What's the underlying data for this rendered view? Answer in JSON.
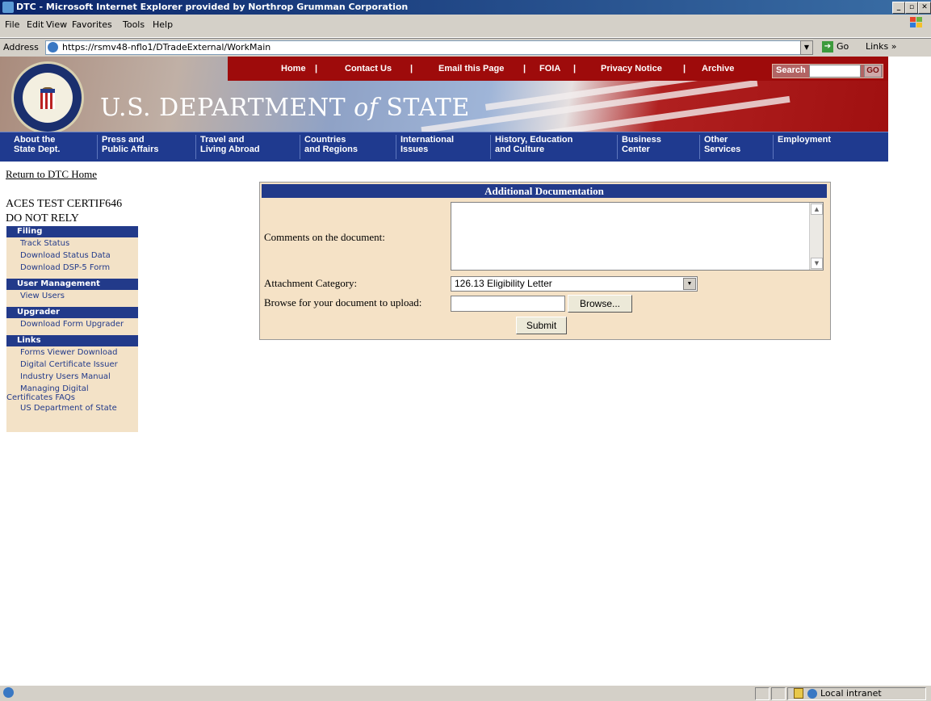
{
  "window": {
    "title": "DTC - Microsoft Internet Explorer provided by Northrop Grumman Corporation"
  },
  "menu": [
    "File",
    "Edit",
    "View",
    "Favorites",
    "Tools",
    "Help"
  ],
  "address": {
    "label": "Address",
    "url": "https://rsmv48-nflo1/DTradeExternal/WorkMain",
    "go_label": "Go",
    "links_label": "Links"
  },
  "banner": {
    "top_nav": [
      "Home",
      "Contact Us",
      "Email this Page",
      "FOIA",
      "Privacy Notice",
      "Archive"
    ],
    "search_label": "Search",
    "search_go": "GO",
    "brand_pre": "U.S. DEPARTMENT ",
    "brand_of": "of",
    "brand_post": " STATE",
    "main_nav": [
      "About the\nState Dept.",
      "Press and\nPublic Affairs",
      "Travel and\nLiving Abroad",
      "Countries\nand Regions",
      "International\nIssues",
      "History, Education\nand Culture",
      "Business\nCenter",
      "Other\nServices",
      "Employment"
    ]
  },
  "return_link": "Return to DTC Home",
  "user_line1": "ACES TEST CERTIF646",
  "user_line2": "DO NOT RELY",
  "sidebar": {
    "filing_header": "Filing",
    "filing_items": [
      "Track Status",
      "Download Status Data",
      "Download DSP-5 Form"
    ],
    "user_mgmt_header": "User Management",
    "user_mgmt_items": [
      "View Users"
    ],
    "upgrader_header": "Upgrader",
    "upgrader_items": [
      "Download Form Upgrader"
    ],
    "links_header": "Links",
    "links_items": [
      "Forms Viewer Download",
      "Digital Certificate Issuer",
      "Industry Users Manual"
    ],
    "links_item_managing_1": "Managing Digital",
    "links_item_managing_2": "Certificates FAQs",
    "links_item_last": "US Department of State"
  },
  "form": {
    "title": "Additional Documentation",
    "comments_label": "Comments on the document:",
    "comments_value": "",
    "attachment_label": "Attachment Category:",
    "attachment_value": "126.13 Eligibility Letter",
    "browse_label": "Browse for your document to upload:",
    "file_value": "",
    "browse_button": "Browse...",
    "submit_button": "Submit"
  },
  "status": {
    "zone": "Local intranet"
  }
}
